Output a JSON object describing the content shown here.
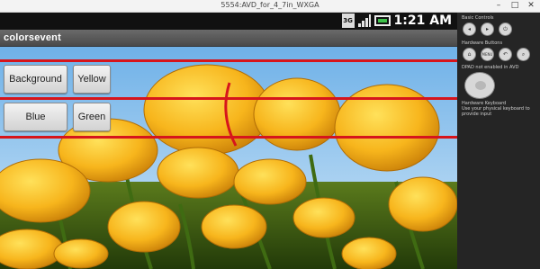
{
  "window": {
    "title": "5554:AVD_for_4_7in_WXGA",
    "minimize": "–",
    "maximize": "□",
    "close": "✕"
  },
  "statusbar": {
    "network_label": "3G",
    "time": "1:21 AM"
  },
  "app": {
    "title": "colorsevent"
  },
  "buttons": {
    "background": "Background",
    "yellow": "Yellow",
    "blue": "Blue",
    "green": "Green"
  },
  "panel": {
    "basic_controls": "Basic Controls",
    "hardware_buttons": "Hardware Buttons",
    "dpad_label": "DPAD not enabled in AVD",
    "hardware_keyboard": "Hardware Keyboard",
    "keyboard_hint": "Use your physical keyboard to provide input",
    "home_label": "HOME",
    "menu_label": "MENU"
  },
  "colors": {
    "accent_red_lines": "#d6151c",
    "action_bar": "#5a5a5a",
    "status_bar": "#111111",
    "panel_bg": "#252525",
    "battery_green": "#3ec24a"
  }
}
